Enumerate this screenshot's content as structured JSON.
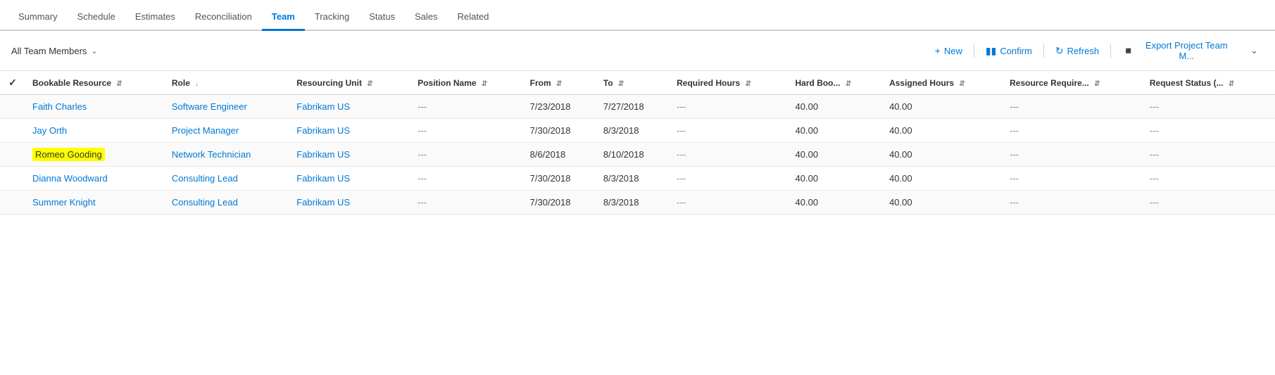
{
  "nav": {
    "tabs": [
      {
        "label": "Summary",
        "active": false
      },
      {
        "label": "Schedule",
        "active": false
      },
      {
        "label": "Estimates",
        "active": false
      },
      {
        "label": "Reconciliation",
        "active": false
      },
      {
        "label": "Team",
        "active": true
      },
      {
        "label": "Tracking",
        "active": false
      },
      {
        "label": "Status",
        "active": false
      },
      {
        "label": "Sales",
        "active": false
      },
      {
        "label": "Related",
        "active": false
      }
    ]
  },
  "toolbar": {
    "filter_label": "All Team Members",
    "new_label": "New",
    "confirm_label": "Confirm",
    "refresh_label": "Refresh",
    "export_label": "Export Project Team M..."
  },
  "table": {
    "columns": [
      {
        "label": "Bookable Resource",
        "sortable": true
      },
      {
        "label": "Role",
        "sortable": true
      },
      {
        "label": "Resourcing Unit",
        "sortable": true
      },
      {
        "label": "Position Name",
        "sortable": true
      },
      {
        "label": "From",
        "sortable": true
      },
      {
        "label": "To",
        "sortable": true
      },
      {
        "label": "Required Hours",
        "sortable": true
      },
      {
        "label": "Hard Boo...",
        "sortable": true
      },
      {
        "label": "Assigned Hours",
        "sortable": true
      },
      {
        "label": "Resource Require...",
        "sortable": true
      },
      {
        "label": "Request Status (...",
        "sortable": true
      }
    ],
    "rows": [
      {
        "resource": "Faith Charles",
        "role": "Software Engineer",
        "resourcing_unit": "Fabrikam US",
        "position": "---",
        "from": "7/23/2018",
        "to": "7/27/2018",
        "required_hours": "---",
        "hard_boo": "40.00",
        "assigned_hours": "40.00",
        "resource_req": "---",
        "request_status": "---",
        "highlighted": false
      },
      {
        "resource": "Jay Orth",
        "role": "Project Manager",
        "resourcing_unit": "Fabrikam US",
        "position": "---",
        "from": "7/30/2018",
        "to": "8/3/2018",
        "required_hours": "---",
        "hard_boo": "40.00",
        "assigned_hours": "40.00",
        "resource_req": "---",
        "request_status": "---",
        "highlighted": false
      },
      {
        "resource": "Romeo Gooding",
        "role": "Network Technician",
        "resourcing_unit": "Fabrikam US",
        "position": "---",
        "from": "8/6/2018",
        "to": "8/10/2018",
        "required_hours": "---",
        "hard_boo": "40.00",
        "assigned_hours": "40.00",
        "resource_req": "---",
        "request_status": "---",
        "highlighted": true
      },
      {
        "resource": "Dianna Woodward",
        "role": "Consulting Lead",
        "resourcing_unit": "Fabrikam US",
        "position": "---",
        "from": "7/30/2018",
        "to": "8/3/2018",
        "required_hours": "---",
        "hard_boo": "40.00",
        "assigned_hours": "40.00",
        "resource_req": "---",
        "request_status": "---",
        "highlighted": false
      },
      {
        "resource": "Summer Knight",
        "role": "Consulting Lead",
        "resourcing_unit": "Fabrikam US",
        "position": "---",
        "from": "7/30/2018",
        "to": "8/3/2018",
        "required_hours": "---",
        "hard_boo": "40.00",
        "assigned_hours": "40.00",
        "resource_req": "---",
        "request_status": "---",
        "highlighted": false
      }
    ]
  }
}
